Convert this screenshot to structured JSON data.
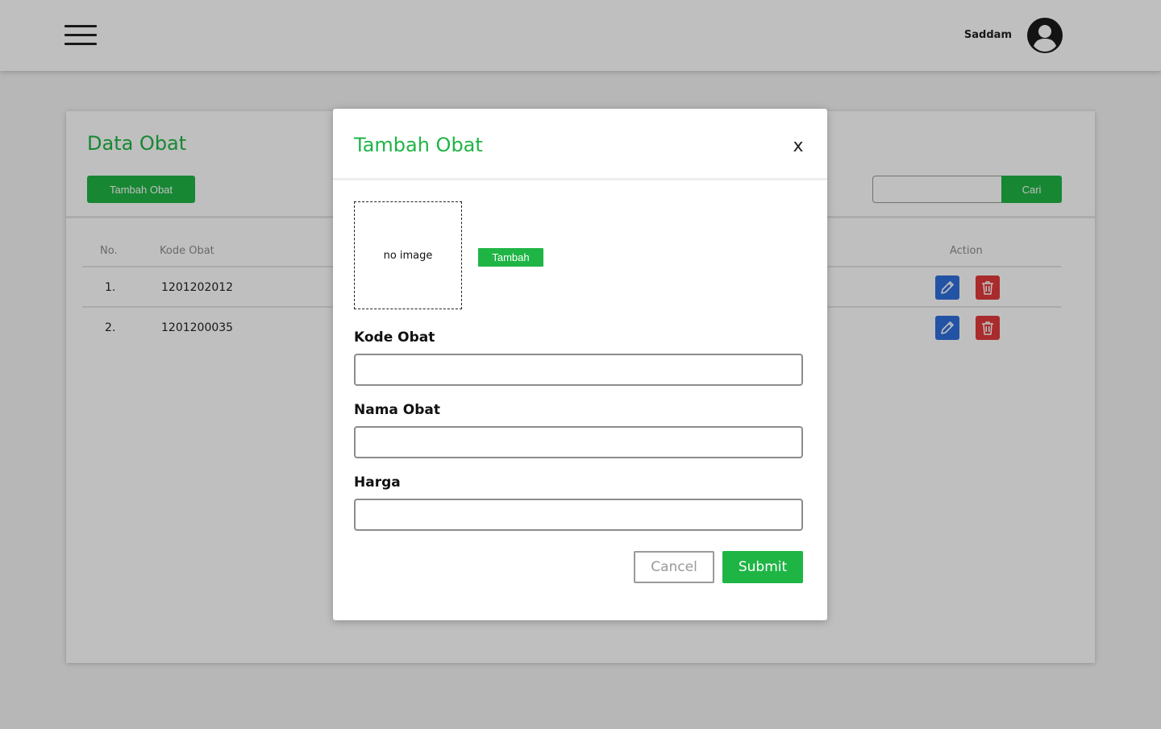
{
  "header": {
    "username": "Saddam"
  },
  "card": {
    "title": "Data Obat",
    "add_button": "Tambah Obat",
    "search_button": "Cari",
    "columns": {
      "no": "No.",
      "kode": "Kode Obat",
      "action": "Action"
    },
    "rows": [
      {
        "no": "1.",
        "kode": "1201202012"
      },
      {
        "no": "2.",
        "kode": "1201200035"
      }
    ]
  },
  "modal": {
    "title": "Tambah Obat",
    "close": "x",
    "image_placeholder": "no image",
    "image_add_button": "Tambah",
    "fields": [
      {
        "label": "Kode Obat",
        "value": ""
      },
      {
        "label": "Nama Obat",
        "value": ""
      },
      {
        "label": "Harga",
        "value": ""
      }
    ],
    "cancel": "Cancel",
    "submit": "Submit"
  },
  "colors": {
    "accent": "#1fb545",
    "edit": "#2f6fdb",
    "delete": "#e23a3a"
  },
  "icons": [
    "menu-icon",
    "user-avatar-icon",
    "pencil-icon",
    "trash-icon",
    "close-icon"
  ]
}
